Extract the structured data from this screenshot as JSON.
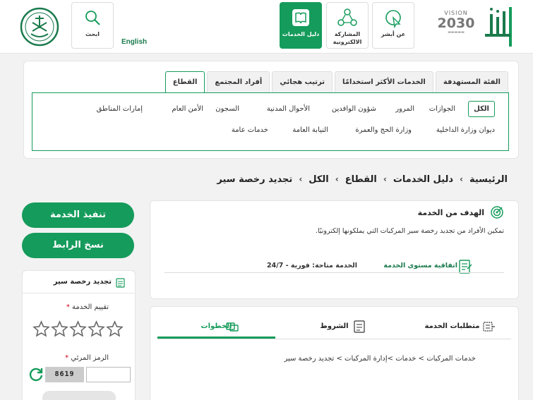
{
  "header": {
    "vision_label": "VISION",
    "vision_year": "2030",
    "buttons": [
      {
        "label": "عن أبشر",
        "icon": "cursor-click-icon"
      },
      {
        "label": "المشاركة الالكترونية",
        "icon": "network-icon"
      },
      {
        "label": "دليل الخدمات",
        "icon": "book-icon",
        "active": true
      },
      {
        "label": "ابحث",
        "icon": "search-icon"
      }
    ],
    "language": "English"
  },
  "sector_tabs": [
    "القطاع",
    "أفراد المجتمع",
    "ترتيب هجائي",
    "الخدمات الأكثر استخدامًا",
    "الفئة المستهدفة"
  ],
  "sectors_row1": [
    "الكل",
    "الجوازات",
    "المرور",
    "شؤون الوافدين",
    "الأحوال المدنية",
    "السجون",
    "الأمن العام",
    "إمارات المناطق"
  ],
  "sectors_row2": [
    "ديوان وزارة الداخلية",
    "وزارة الحج والعمرة",
    "النيابة العامة",
    "خدمات عامة"
  ],
  "breadcrumb": [
    "الرئيسية",
    "دليل الخدمات",
    "القطاع",
    "الكل",
    "تجديد رخصة سير"
  ],
  "goal": {
    "title": "الهدف من الخدمة",
    "text": "تمكين الأفراد من تجديد رخصة سير المركبات التي يملكونها إلكترونيًا.",
    "sla": "اتفاقية مستوى الخدمة",
    "availability": "الخدمة متاحة: فورية - 24/7"
  },
  "steps_tabs": [
    "الخطوات",
    "الشروط",
    "متطلبات الخدمة"
  ],
  "steps_path": "خدمات المركبات > خدمات >إدارة المركبات > تجديد رخصة سير",
  "actions": {
    "execute": "تنفيذ الخدمة",
    "copy_link": "نسخ الرابط"
  },
  "rating": {
    "title": "تجديد رخصة سير",
    "rate_label": "تقييم الخدمة",
    "captcha_label": "الرمز المرئي",
    "required_mark": "*",
    "captcha_text": "8619",
    "star_count": 5
  },
  "colors": {
    "primary": "#159b5b",
    "accent_text": "#1a7a4c"
  }
}
